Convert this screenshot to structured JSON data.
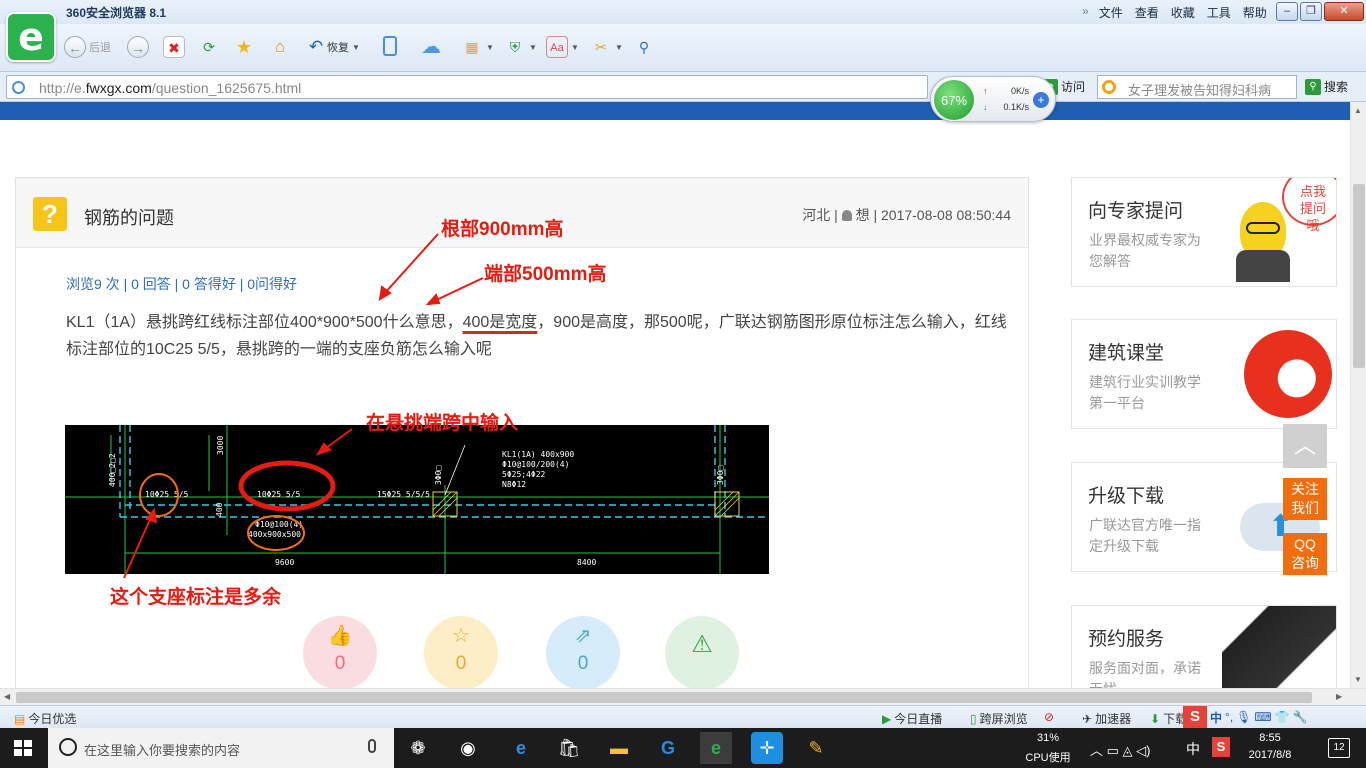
{
  "browser": {
    "title": "360安全浏览器 8.1",
    "menu": [
      "文件",
      "查看",
      "收藏",
      "工具",
      "帮助"
    ],
    "toolbar": {
      "back_label": "后退",
      "restore_label": "恢复"
    },
    "url_prefix": "http://e.",
    "url_domain": "fwxgx.com",
    "url_path": "/question_1625675.html",
    "visit_label": "访问",
    "search_placeholder": "女子理发被告知得妇科病",
    "search_label": "搜索",
    "speed": {
      "percent": "67%",
      "up": "0K/s",
      "down": "0.1K/s"
    }
  },
  "question": {
    "title": "钢筋的问题",
    "location": "河北",
    "author": "想",
    "datetime": "2017-08-08 08:50:44",
    "stats": "浏览9 次 | 0 回答 | 0 答得好 | 0问得好",
    "body_part1": "KL1（1A）悬挑跨红线标注部位400*900*500什么意思，",
    "body_underlined": "400是宽度",
    "body_part2": "，900是高度，那500呢，广联达钢筋图形原位标注怎么输入，红线标注部位的10C25 5/5，悬挑跨的一端的支座负筋怎么输入呢",
    "actions": [
      {
        "icon": "thumbs-up-icon",
        "glyph": "👍",
        "count": "0"
      },
      {
        "icon": "star-icon",
        "glyph": "☆",
        "count": "0"
      },
      {
        "icon": "share-icon",
        "glyph": "⇗",
        "count": "0"
      },
      {
        "icon": "warning-icon",
        "glyph": "⚠",
        "count": ""
      }
    ]
  },
  "annotations": {
    "root_height": "根部900mm高",
    "end_height": "端部500mm高",
    "input_here": "在悬挑端跨中输入",
    "redundant": "这个支座标注是多余"
  },
  "cad_drawing": {
    "labels": [
      "400□2□2",
      "3000",
      "10Φ25 5/5",
      "10Φ25 5/5",
      "15Φ25 5/5/5",
      "KL1(1A) 400x900",
      "Φ10@100/200(4)",
      "5Φ25;4Φ22",
      "N8Φ12",
      "Φ10@100(4)",
      "400x900x500",
      "3Φ0□",
      "3Φ0□",
      "400",
      "9600",
      "8400"
    ]
  },
  "sidebar": {
    "cards": [
      {
        "title": "向专家提问",
        "desc": "业界最权威专家为您解答",
        "bubble": "点我提问哦"
      },
      {
        "title": "建筑课堂",
        "desc": "建筑行业实训教学第一平台"
      },
      {
        "title": "升级下载",
        "desc": "广联达官方唯一指定升级下载"
      },
      {
        "title": "预约服务",
        "desc": "服务面对面，承诺无忧"
      }
    ],
    "follow_label": "关注我们",
    "qq_label": "QQ咨询"
  },
  "statusbar": {
    "left": "今日优选",
    "live": "今日直播",
    "split": "跨屏浏览",
    "accelerate": "加速器",
    "download": "下载"
  },
  "taskbar": {
    "search_placeholder": "在这里输入你要搜索的内容",
    "cpu_percent": "31%",
    "cpu_label": "CPU使用",
    "ime": "中",
    "time": "8:55",
    "date": "2017/8/8",
    "notifications": "12"
  },
  "colors": {
    "brand_green": "#2bb24c",
    "page_blue": "#1e5fb4",
    "annotation_red": "#e41d13",
    "float_orange": "#f26d0e"
  }
}
